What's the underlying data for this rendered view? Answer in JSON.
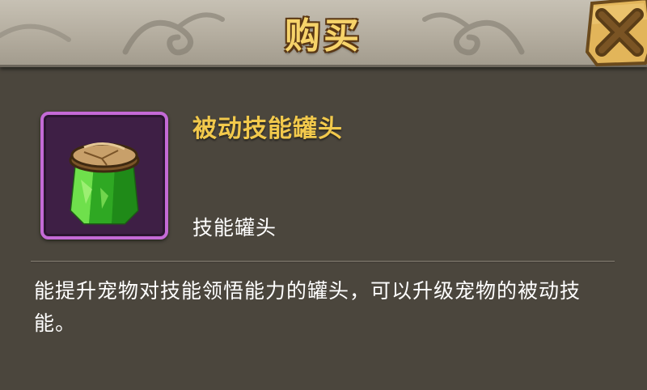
{
  "dialog": {
    "title": "购买",
    "close_icon": "close-x-icon"
  },
  "item": {
    "name": "被动技能罐头",
    "type": "技能罐头",
    "icon": "green-crystal-jar-icon",
    "description": "能提升宠物对技能领悟能力的罐头，可以升级宠物的被动技能。"
  },
  "colors": {
    "title": "#f6d36a",
    "item_name": "#f2c94c",
    "frame_border": "#c46ad6",
    "frame_fill": "#3e1f45",
    "panel_bg": "#4b463d"
  }
}
